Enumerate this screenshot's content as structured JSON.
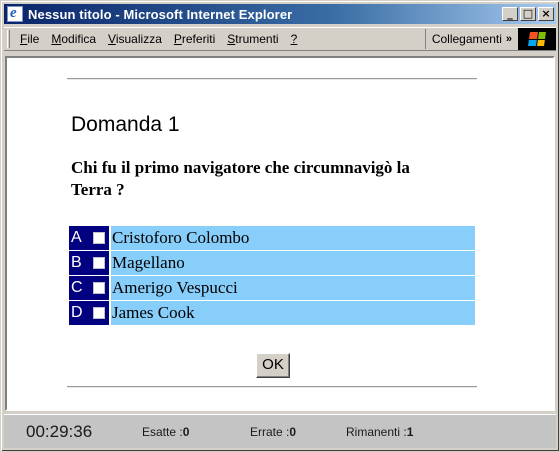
{
  "window": {
    "title": "Nessun titolo - Microsoft Internet Explorer",
    "buttons": {
      "minimize": "_",
      "maximize": "□",
      "close": "×"
    }
  },
  "menu": {
    "items": [
      {
        "accel": "F",
        "rest": "ile"
      },
      {
        "accel": "M",
        "rest": "odifica"
      },
      {
        "accel": "V",
        "rest": "isualizza"
      },
      {
        "accel": "P",
        "rest": "referiti"
      },
      {
        "accel": "S",
        "rest": "trumenti"
      },
      {
        "accel": "?",
        "rest": ""
      }
    ],
    "links_label": "Collegamenti",
    "chevron": "»"
  },
  "quiz": {
    "title": "Domanda 1",
    "question": "Chi fu il primo navigatore che circumnavigò la Terra ?",
    "answers": [
      {
        "letter": "A",
        "text": "Cristoforo Colombo"
      },
      {
        "letter": "B",
        "text": "Magellano"
      },
      {
        "letter": "C",
        "text": "Amerigo Vespucci"
      },
      {
        "letter": "D",
        "text": "James Cook"
      }
    ],
    "ok_label": "OK"
  },
  "status": {
    "timer": "00:29:36",
    "esatte_label": "Esatte :",
    "esatte_value": "0",
    "errate_label": "Errate :",
    "errate_value": "0",
    "rimanenti_label": "Rimanenti :",
    "rimanenti_value": "1"
  },
  "colors": {
    "answer_key_bg": "#000080",
    "answer_text_bg": "#87cefa",
    "titlebar_start": "#0a246a"
  }
}
